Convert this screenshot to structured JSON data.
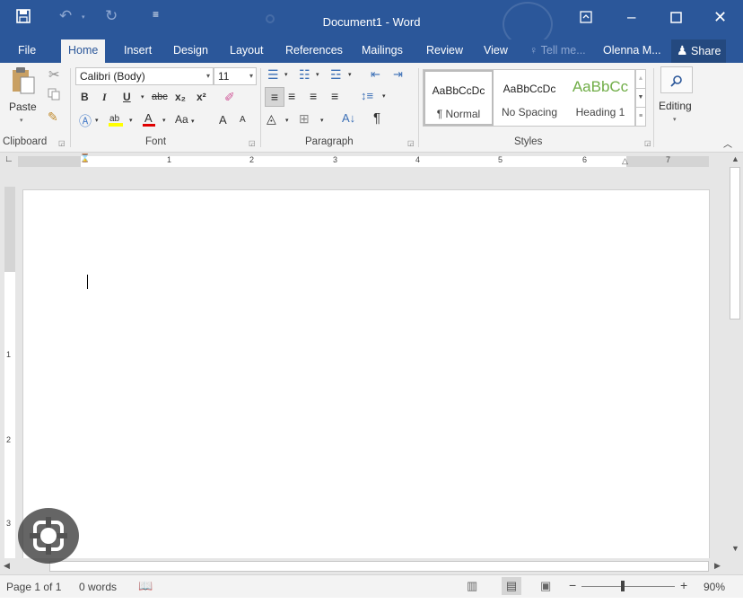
{
  "window": {
    "title": "Document1 - Word",
    "quick_access": {
      "save_icon": "save-icon",
      "undo_icon": "undo-icon",
      "redo_icon": "redo-icon",
      "customize_icon": "customize-qat-icon"
    },
    "controls": {
      "ribbon_options_icon": "ribbon-display-options-icon",
      "minimize_icon": "minimize-icon",
      "maximize_icon": "maximize-icon",
      "close_icon": "close-icon"
    }
  },
  "tabs": [
    {
      "label": "File"
    },
    {
      "label": "Home",
      "active": true
    },
    {
      "label": "Insert"
    },
    {
      "label": "Design"
    },
    {
      "label": "Layout"
    },
    {
      "label": "References"
    },
    {
      "label": "Mailings"
    },
    {
      "label": "Review"
    },
    {
      "label": "View"
    }
  ],
  "tell_me": "Tell me...",
  "user": "Olenna M...",
  "share": "Share",
  "ribbon": {
    "clipboard": {
      "paste_label": "Paste",
      "group_label": "Clipboard"
    },
    "font": {
      "font_name": "Calibri (Body)",
      "font_size": "11",
      "bold": "B",
      "italic": "I",
      "underline": "U",
      "strikethrough": "abc",
      "subscript": "x₂",
      "superscript": "x²",
      "change_case": "Aa",
      "grow_font": "A",
      "shrink_font": "A",
      "group_label": "Font"
    },
    "paragraph": {
      "group_label": "Paragraph"
    },
    "styles": {
      "items": [
        {
          "sample": "AaBbCcDc",
          "name": "¶ Normal"
        },
        {
          "sample": "AaBbCcDc",
          "name": "No Spacing"
        },
        {
          "sample": "AaBbCc",
          "name": "Heading 1"
        }
      ],
      "group_label": "Styles"
    },
    "editing": {
      "label": "Editing"
    }
  },
  "ruler": {
    "h_numbers": [
      "1",
      "2",
      "3",
      "4",
      "5",
      "6",
      "7"
    ],
    "v_numbers": [
      "1",
      "2",
      "3"
    ]
  },
  "status": {
    "page": "Page 1 of 1",
    "words": "0 words",
    "zoom": "90%"
  },
  "colors": {
    "accent": "#2b579a",
    "heading": "#70ad47",
    "font_color": "#e00000",
    "highlight": "#ffff00"
  }
}
